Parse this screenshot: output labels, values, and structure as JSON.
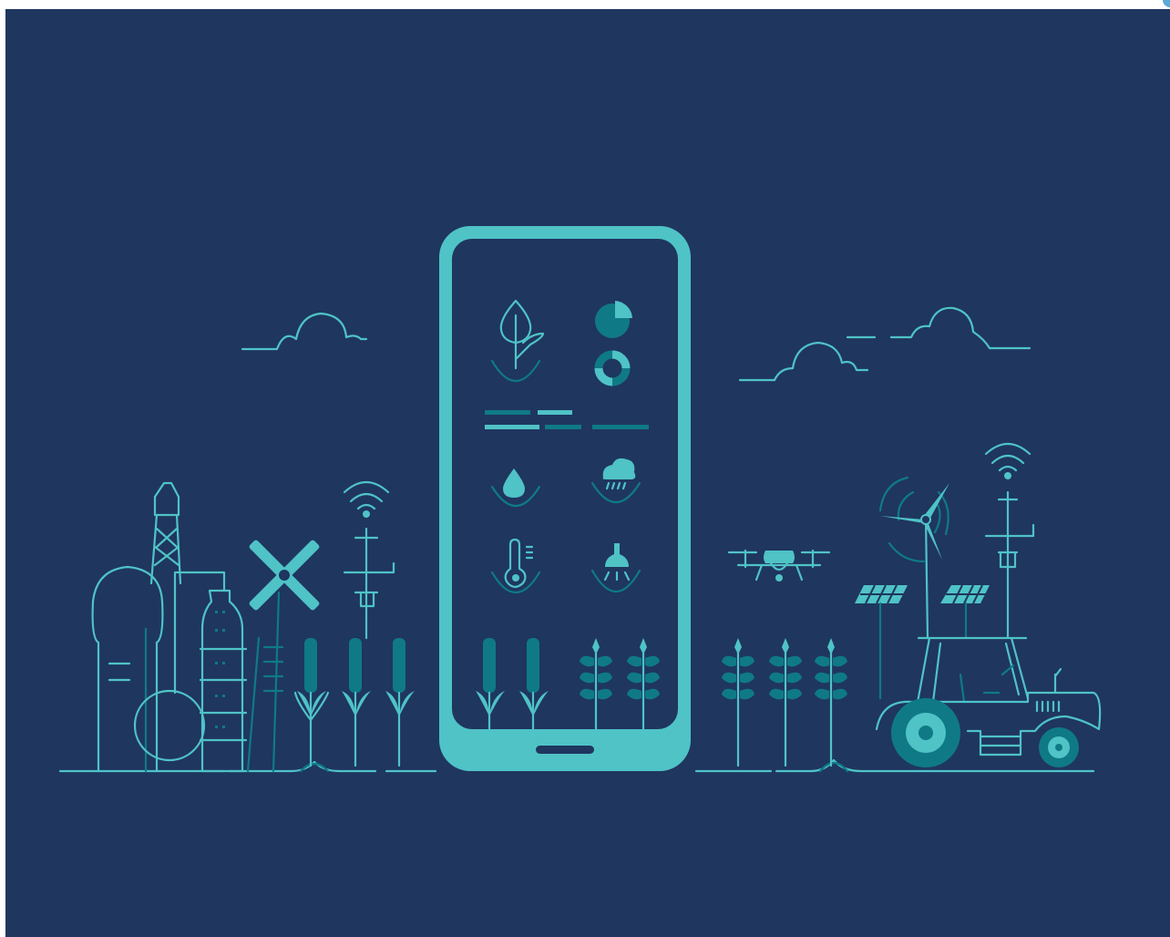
{
  "colors": {
    "background": "#1f365f",
    "accent_light": "#4fc3c6",
    "accent_dark": "#0f7a86"
  },
  "phone": {
    "icons": [
      "plant-growth-icon",
      "pie-chart-icon",
      "donut-chart-icon",
      "water-drop-icon",
      "rain-cloud-icon",
      "thermometer-icon",
      "sprinkler-icon"
    ]
  },
  "scene_elements": [
    "cloud-icon",
    "refinery-icon",
    "windmill-icon",
    "wifi-sensor-icon",
    "corn-plant-icon",
    "wheat-plant-icon",
    "drone-icon",
    "wind-turbine-icon",
    "solar-panel-icon",
    "tractor-icon"
  ]
}
